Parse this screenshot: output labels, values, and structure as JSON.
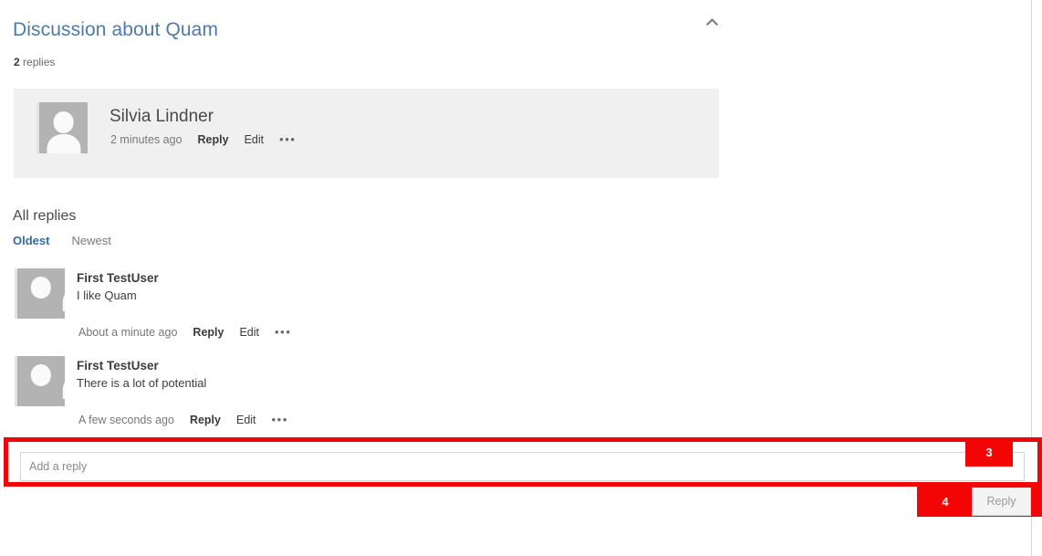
{
  "header": {
    "title": "Discussion about Quam",
    "collapse_icon": "chevron-up-icon",
    "reply_count_number": "2",
    "reply_count_label": " replies"
  },
  "root_post": {
    "avatar_icon": "user-avatar-icon",
    "author": "Silvia Lindner",
    "time": "2 minutes ago",
    "reply_label": "Reply",
    "edit_label": "Edit",
    "more_label": "•••"
  },
  "replies_section": {
    "heading": "All replies",
    "sort": {
      "oldest": "Oldest",
      "newest": "Newest",
      "selected": "Oldest"
    },
    "items": [
      {
        "avatar_icon": "user-avatar-icon",
        "author": "First TestUser",
        "body": "I like Quam",
        "time": "About a minute ago",
        "reply_label": "Reply",
        "edit_label": "Edit",
        "more_label": "•••"
      },
      {
        "avatar_icon": "user-avatar-icon",
        "author": "First TestUser",
        "body": "There is a lot of potential",
        "time": "A few seconds ago",
        "reply_label": "Reply",
        "edit_label": "Edit",
        "more_label": "•••"
      }
    ]
  },
  "composer": {
    "input_placeholder": "Add a reply",
    "input_value": "",
    "submit_label": "Reply"
  },
  "annotations": {
    "badge_3": "3",
    "badge_4": "4",
    "color": "#f40505"
  },
  "colors": {
    "title_blue": "#4d79ab",
    "link_blue": "#2f6ca3",
    "card_gray": "#f0f0f0",
    "annotation_red": "#f40505"
  }
}
